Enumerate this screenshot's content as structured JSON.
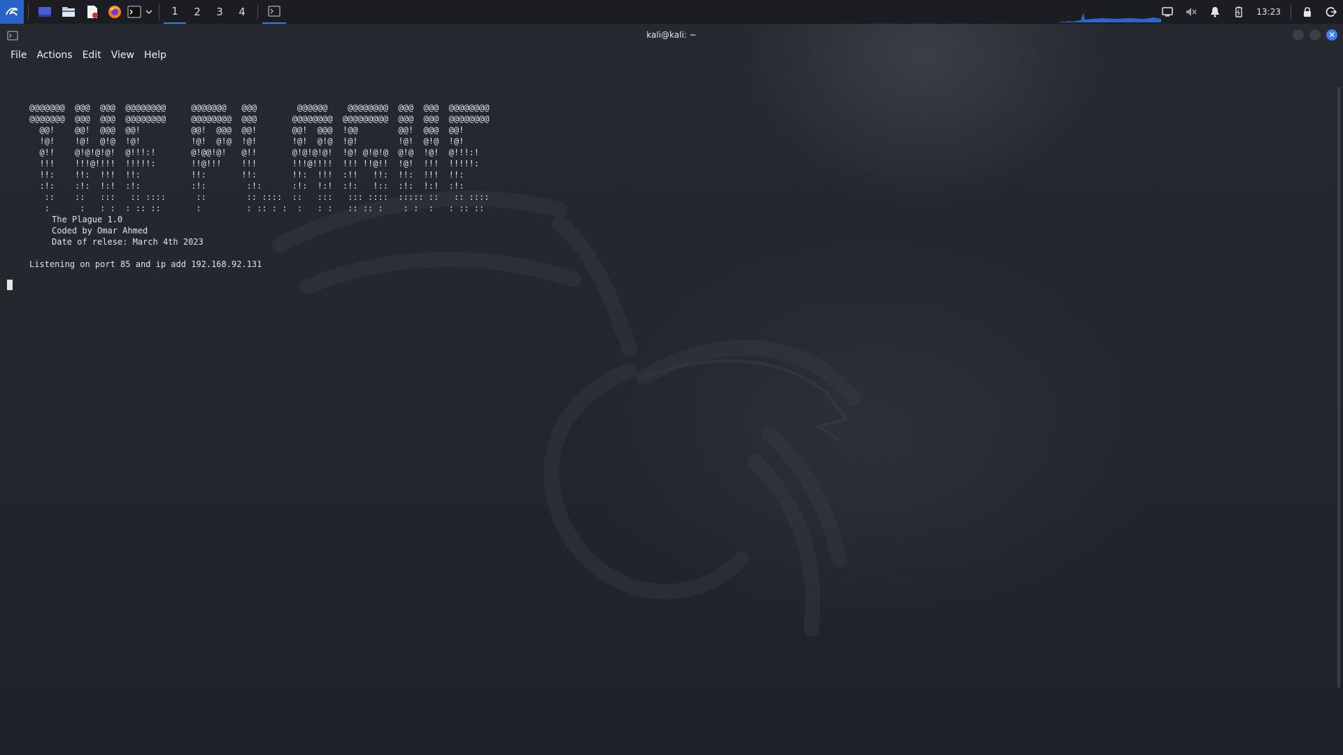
{
  "panel": {
    "workspaces": [
      "1",
      "2",
      "3",
      "4"
    ],
    "active_workspace": "1",
    "clock": "13:23"
  },
  "window": {
    "title": "kali@kali: ~",
    "menu": [
      "File",
      "Actions",
      "Edit",
      "View",
      "Help"
    ]
  },
  "terminal": {
    "banner_ascii": "@@@@@@@  @@@  @@@  @@@@@@@@     @@@@@@@   @@@        @@@@@@    @@@@@@@@  @@@  @@@  @@@@@@@@\n@@@@@@@  @@@  @@@  @@@@@@@@     @@@@@@@@  @@@       @@@@@@@@  @@@@@@@@@  @@@  @@@  @@@@@@@@\n  @@!    @@!  @@@  @@!          @@!  @@@  @@!       @@!  @@@  !@@        @@!  @@@  @@!\n  !@!    !@!  @!@  !@!          !@!  @!@  !@!       !@!  @!@  !@!        !@!  @!@  !@!\n  @!!    @!@!@!@!  @!!!:!       @!@@!@!   @!!       @!@!@!@!  !@! @!@!@  @!@  !@!  @!!!:!\n  !!!    !!!@!!!!  !!!!!:       !!@!!!    !!!       !!!@!!!!  !!! !!@!!  !@!  !!!  !!!!!:\n  !!:    !!:  !!!  !!:          !!:       !!:       !!:  !!!  :!!   !!:  !!:  !!!  !!:\n  :!:    :!:  !:!  :!:          :!:        :!:      :!:  !:!  :!:   !::  :!:  !:!  :!:\n   ::    ::   :::   :: ::::      ::        :: ::::  ::   :::   ::: ::::  ::::: ::   :: ::::\n   :      :   : :  : :: ::       :         : :: : :  :   : :   :: :: :    : :  :   : :: ::",
    "info_line1": "The Plague 1.0",
    "info_line2": "Coded by Omar Ahmed",
    "info_line3": "Date of relese: March 4th 2023",
    "listen_line": "Listening on port 85 and ip add 192.168.92.131"
  },
  "icons": {
    "panel_left": [
      "kali-menu-icon",
      "desktop-icon",
      "file-manager-icon",
      "text-editor-icon",
      "firefox-icon",
      "terminal-icon",
      "chevron-down-icon"
    ],
    "panel_right": [
      "display-icon",
      "volume-muted-icon",
      "bell-icon",
      "battery-icon",
      "lock-icon",
      "logout-icon"
    ]
  },
  "colors": {
    "accent": "#3d7bd9",
    "panel_bg": "#1b1d22",
    "terminal_text": "#e1e3e6"
  }
}
